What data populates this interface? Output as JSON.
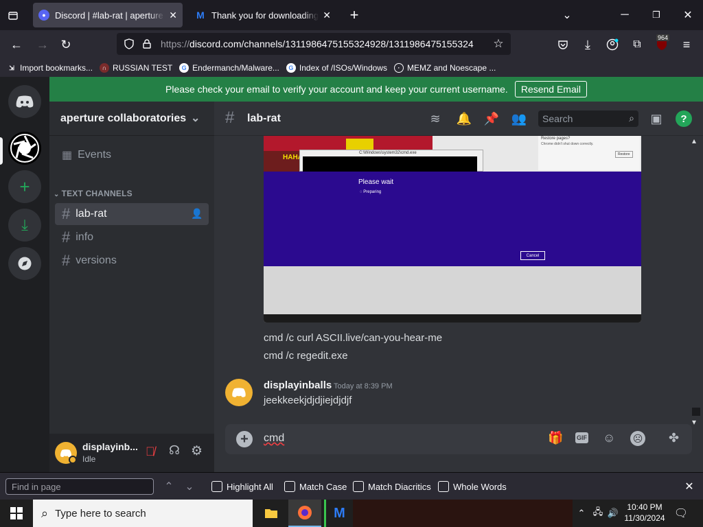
{
  "browser": {
    "tabs": [
      {
        "title": "Discord | #lab-rat | aperture coll",
        "active": true,
        "icon": "discord-icon"
      },
      {
        "title": "Thank you for downloading Ma",
        "active": false,
        "icon": "malwarebytes-icon"
      }
    ],
    "url_prefix": "https://",
    "url_rest": "discord.com/channels/1311986475155324928/1311986475155324",
    "extension_badge": "964",
    "bookmarks": [
      "Import bookmarks...",
      "RUSSIAN TEST",
      "Endermanch/Malware...",
      "Index of /ISOs/Windows",
      "MEMZ and Noescape ..."
    ]
  },
  "banner": {
    "text": "Please check your email to verify your account and keep your current username.",
    "button": "Resend Email"
  },
  "server": {
    "name": "aperture collaboratories",
    "events": "Events",
    "category": "TEXT CHANNELS",
    "channels": [
      "lab-rat",
      "info",
      "versions"
    ]
  },
  "user": {
    "name": "displayinb...",
    "status": "Idle"
  },
  "chat": {
    "channel": "lab-rat",
    "search_placeholder": "Search",
    "screenshot": {
      "window_title": "C:\\Windows\\system32\\cmd.exe",
      "please_wait": "Please wait",
      "preparing": "Preparing",
      "cancel": "Cancel",
      "haha": "HAHA",
      "restore": "Restore",
      "side_text1": "Restore pages?",
      "side_text2": "Chrome didn't shut down correctly."
    },
    "lines": [
      "cmd /c curl ASCII.live/can-you-hear-me",
      "cmd /c regedit.exe"
    ],
    "message": {
      "author": "displayinballs",
      "time": "Today at 8:39 PM",
      "text": "jeekkeekjdjdjiejdjdjf"
    },
    "composer_value": "cmd"
  },
  "findbar": {
    "placeholder": "Find in page",
    "options": [
      "Highlight All",
      "Match Case",
      "Match Diacritics",
      "Whole Words"
    ]
  },
  "taskbar": {
    "search": "Type here to search",
    "time": "10:40 PM",
    "date": "11/30/2024"
  },
  "colors": {
    "accent_green": "#248046",
    "discord_bg": "#313338",
    "blurple": "#2b0a8f"
  }
}
